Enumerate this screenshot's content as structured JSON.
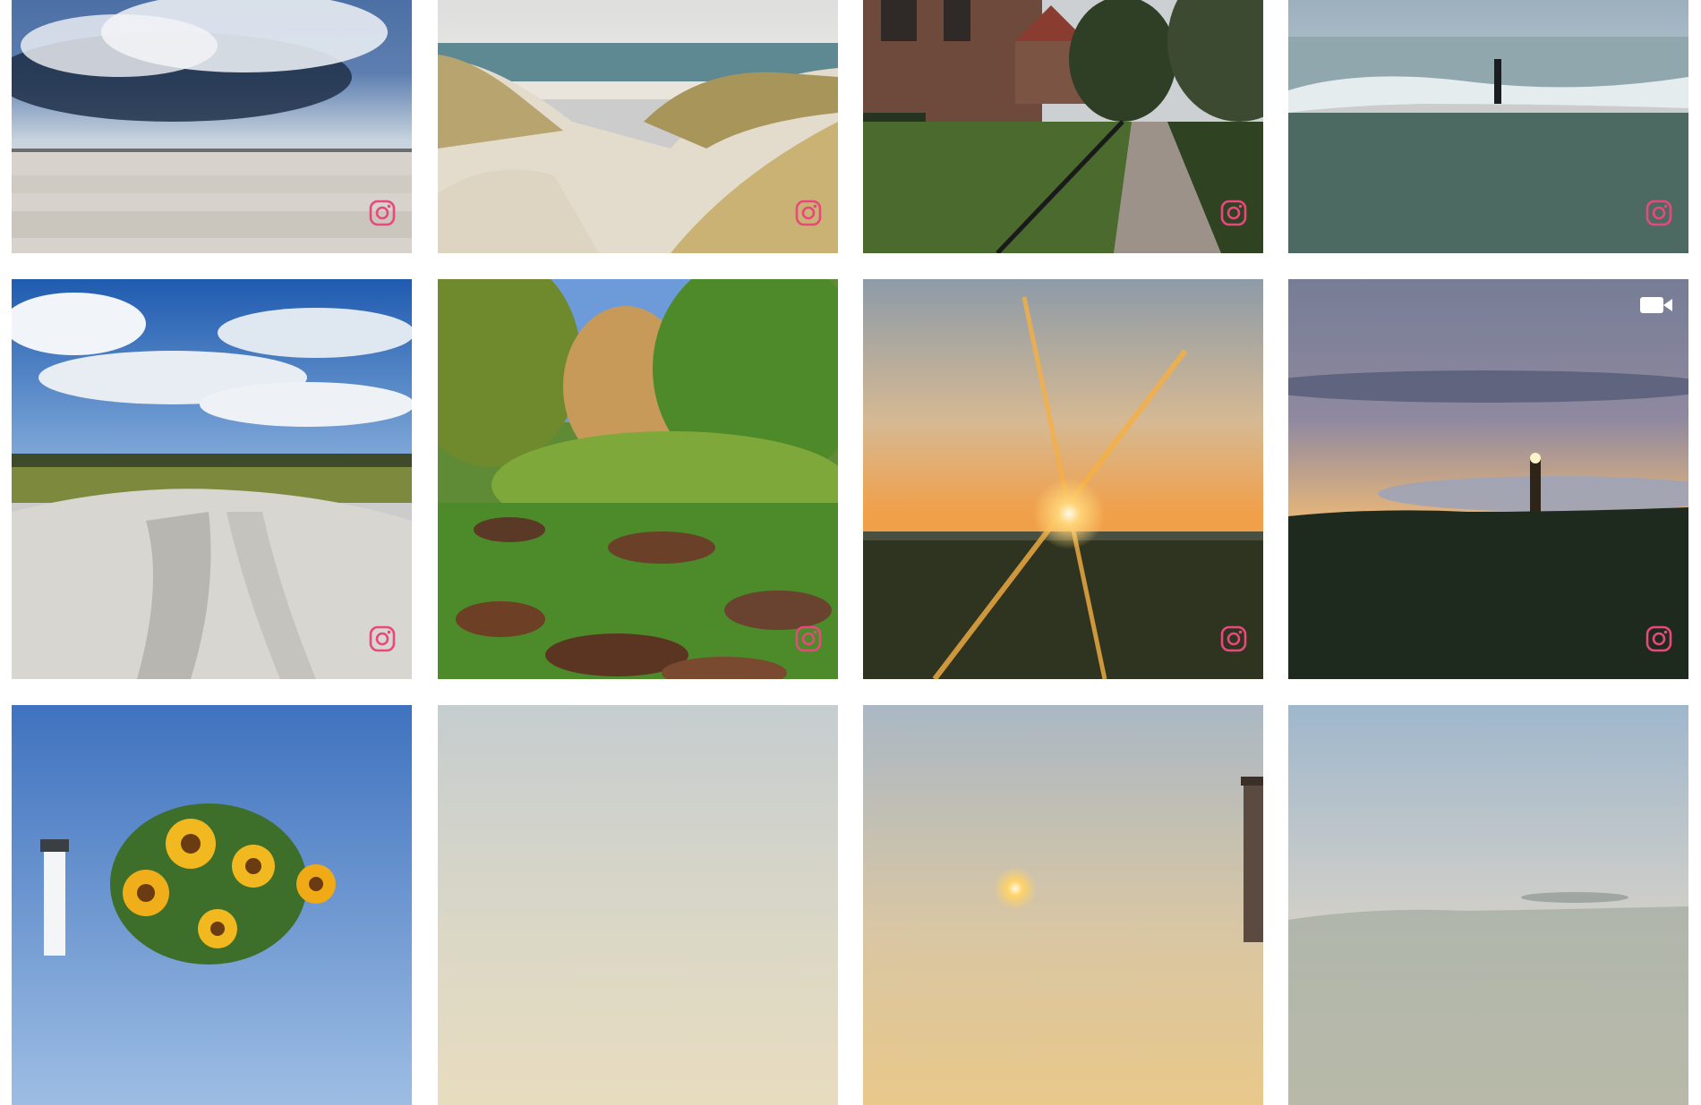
{
  "feed": {
    "posts": [
      {
        "id_label": "storm-clouds-beach",
        "media": "instagram-icon"
      },
      {
        "id_label": "dunes-sea-view",
        "media": "instagram-icon"
      },
      {
        "id_label": "village-garden-path",
        "media": "instagram-icon"
      },
      {
        "id_label": "beach-post-waves",
        "media": "instagram-icon"
      },
      {
        "id_label": "sand-dune-blue-sky",
        "media": "instagram-icon"
      },
      {
        "id_label": "forest-leaves-grass",
        "media": "instagram-icon"
      },
      {
        "id_label": "sunrise-meadow-starburst",
        "media": "instagram-icon"
      },
      {
        "id_label": "lighthouse-dusk",
        "media": "video-camera-icon"
      },
      {
        "id_label": "sunflowers-white-lighthouse",
        "media": "none"
      },
      {
        "id_label": "misty-dawn",
        "media": "none"
      },
      {
        "id_label": "sun-mist-lighthouse",
        "media": "none"
      },
      {
        "id_label": "hazy-landscape",
        "media": "none"
      }
    ]
  },
  "colors": {
    "instagram_accent": "#e8487c",
    "video_icon": "#ffffff",
    "page_background": "#ffffff"
  }
}
